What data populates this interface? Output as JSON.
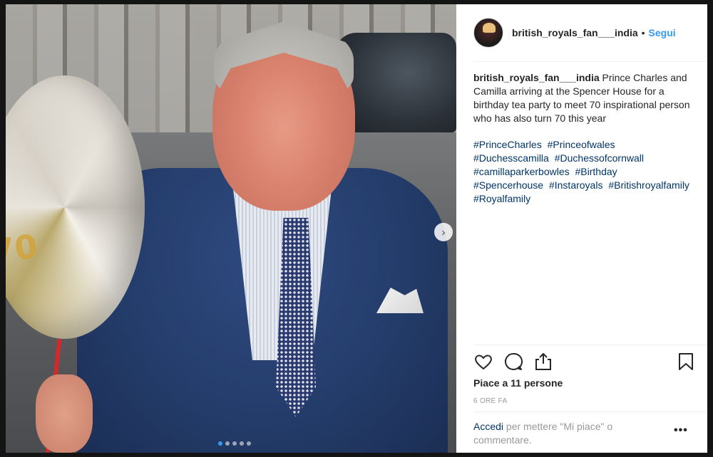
{
  "post": {
    "username": "british_royals_fan___india",
    "follow_label": "Segui",
    "separator": "•",
    "caption_user": "british_royals_fan___india",
    "caption_text": "Prince Charles and Camilla arriving at the Spencer House for a birthday tea party to meet 70 inspirational person who has also turn 70 this year",
    "hashtags": [
      "#PrinceCharles",
      "#Princeofwales",
      "#Duchesscamilla",
      "#Duchessofcornwall",
      "#camillaparkerbowles",
      "#Birthday",
      "#Spencerhouse",
      "#Instaroyals",
      "#Britishroyalfamily",
      "#Royalfamily"
    ],
    "likes_text": "Piace a 11 persone",
    "time_text": "6 ORE FA",
    "login_link": "Accedi",
    "login_text": " per mettere \"Mi piace\" o commentare.",
    "more_label": "•••"
  },
  "carousel": {
    "next_label": "›",
    "total_slides": 5,
    "active_slide": 1
  },
  "icons": {
    "heart": "heart-icon",
    "comment": "comment-icon",
    "share": "share-icon",
    "bookmark": "bookmark-icon"
  },
  "colors": {
    "link_blue": "#3897f0",
    "hashtag_blue": "#003569",
    "text_dark": "#262626",
    "muted": "#999999"
  }
}
